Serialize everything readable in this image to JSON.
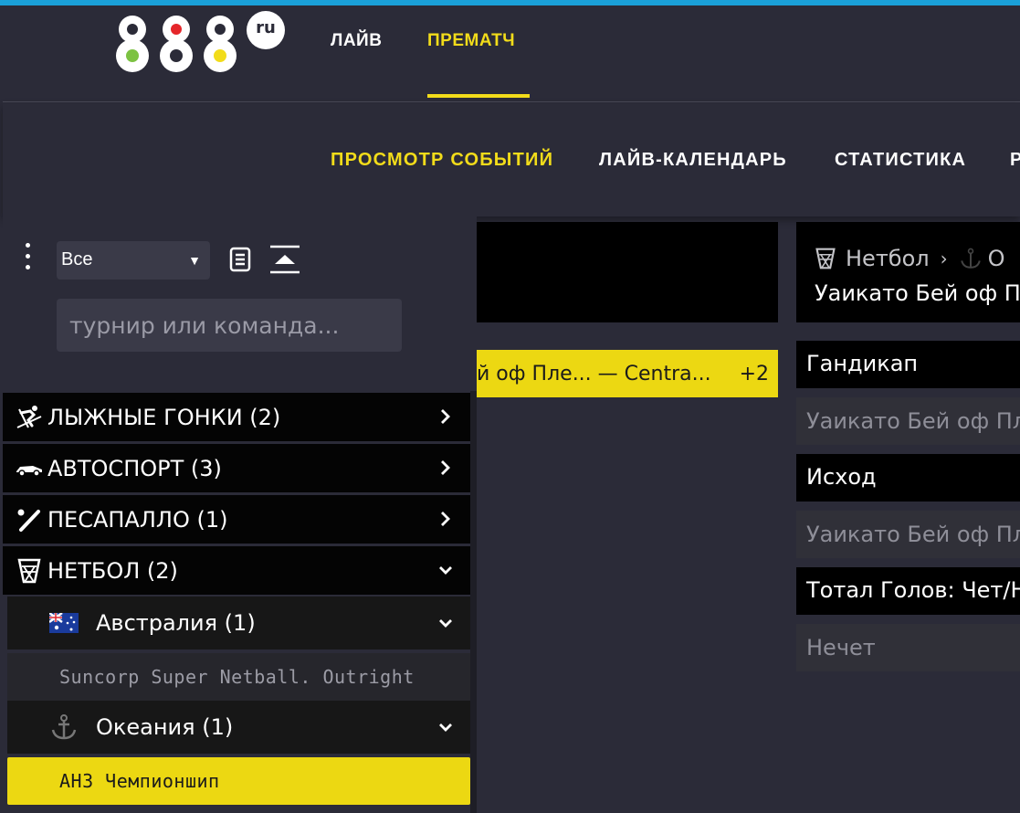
{
  "header": {
    "logo_text": "888",
    "logo_suffix": "ru",
    "nav_live": "ЛАЙВ",
    "nav_prematch": "ПРЕМАТЧ"
  },
  "subnav": {
    "items": [
      "ПРОСМОТР СОБЫТИЙ",
      "ЛАЙВ-КАЛЕНДАРЬ",
      "СТАТИСТИКА",
      "Р"
    ]
  },
  "filter": {
    "selected": "Все",
    "search_placeholder": "турнир или команда..."
  },
  "sports": [
    {
      "label": "ЛЫЖНЫЕ ГОНКИ (2)",
      "icon": "skiing-icon"
    },
    {
      "label": "АВТОСПОРТ (3)",
      "icon": "race-car-icon"
    },
    {
      "label": "ПЕСАПАЛЛО (1)",
      "icon": "bat-icon"
    },
    {
      "label": "НЕТБОЛ (2)",
      "icon": "netball-icon"
    }
  ],
  "netball": {
    "regions": [
      {
        "label": "Австралия (1)",
        "icon": "australia-flag-icon"
      },
      {
        "label": "Океания (1)",
        "icon": "anchor-icon"
      }
    ],
    "tournaments": [
      "Suncorp Super Netball. Outright",
      "АНЗ Чемпионшип"
    ]
  },
  "match_chip": {
    "text": "й оф Пле... — Centra...",
    "extra": "+2"
  },
  "event": {
    "breadcrumb_sport": "Нетбол",
    "breadcrumb_region": "О",
    "title": "Уаикато Бей оф Пл"
  },
  "markets": [
    {
      "title": "Гандикап",
      "outcome": "Уаикато Бей оф Пле"
    },
    {
      "title": "Исход",
      "outcome": "Уаикато Бей оф Пле"
    },
    {
      "title": "Тотал Голов: Чет/Не",
      "outcome": "Нечет"
    }
  ],
  "colors": {
    "accent": "#f2dc1a",
    "background": "#2b2b38",
    "topline": "#1aa0d8"
  }
}
